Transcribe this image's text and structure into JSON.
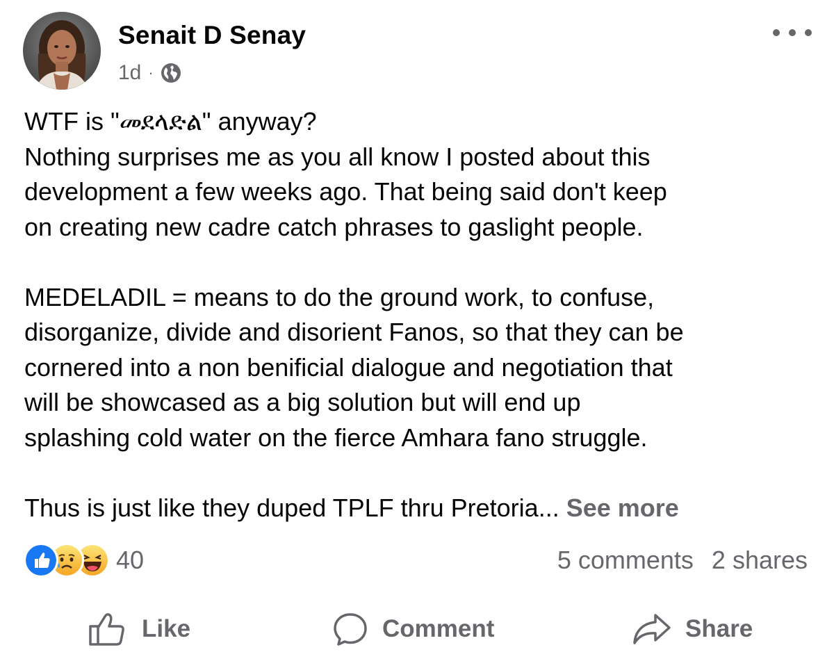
{
  "post": {
    "author": "Senait D Senay",
    "time": "1d",
    "separator": "·",
    "audience_icon": "globe-icon",
    "more_icon": "ellipsis-icon",
    "lines": [
      "WTF is \"መደላድል\" anyway?",
      "Nothing surprises me as you all know I posted about this",
      "development a few weeks ago. That being said don't keep",
      "on creating new cadre catch phrases to gaslight people.",
      "",
      "MEDELADIL = means to do the ground work, to confuse,",
      "disorganize, divide and disorient Fanos, so that they can be",
      "cornered into a non benificial dialogue and negotiation that",
      "will be showcased as a big solution but will end up",
      "splashing cold water on the fierce Amhara  fano struggle.",
      ""
    ],
    "last_line": "Thus is just like they duped TPLF thru Pretoria...",
    "see_more": "See more"
  },
  "reactions": {
    "icons": [
      "like-reaction-icon",
      "sad-reaction-icon",
      "haha-reaction-icon"
    ],
    "count": "40",
    "comments": "5 comments",
    "shares": "2 shares"
  },
  "actions": {
    "like": "Like",
    "comment": "Comment",
    "share": "Share"
  },
  "colors": {
    "like_blue": "#1877f2",
    "emoji_yellow": "#f7b125",
    "secondary_text": "#65676b",
    "primary_text": "#050505"
  }
}
